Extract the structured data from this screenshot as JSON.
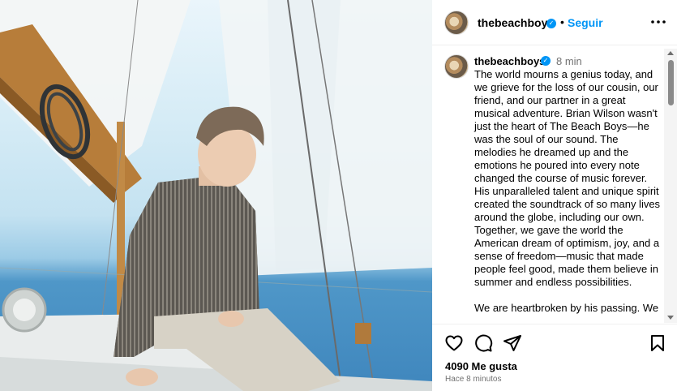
{
  "post": {
    "username": "thebeachboys",
    "verified_glyph": "✓",
    "dot": "•",
    "follow_label": "Seguir",
    "more_icon": "more-horizontal-icon",
    "photo_description_alt": "Young man in striped sweater sitting on a sailboat deck"
  },
  "caption": {
    "username": "thebeachboys",
    "verified_glyph": "✓",
    "time": "8 min",
    "paragraphs": [
      "The world mourns a genius today, and we grieve for the loss of our cousin, our friend, and our partner in a great musical adventure. Brian Wilson wasn't just the heart of The Beach Boys—he was the soul of our sound. The melodies he dreamed up and the emotions he poured into every note changed the course of music forever. His unparalleled talent and unique spirit created the soundtrack of so many lives around the globe, including our own. Together, we gave the world the American dream of optimism, joy, and a sense of freedom—music that made people feel good, made them believe in summer and endless possibilities.",
      "We are heartbroken by his passing. We"
    ]
  },
  "actions": {
    "like_icon": "heart-icon",
    "comment_icon": "comment-icon",
    "share_icon": "send-icon",
    "save_icon": "bookmark-icon",
    "likes_text": "4090 Me gusta",
    "age_text": "Hace 8 minutos"
  },
  "colors": {
    "accent": "#0095f6",
    "muted": "#737373",
    "divider": "#efefef"
  }
}
